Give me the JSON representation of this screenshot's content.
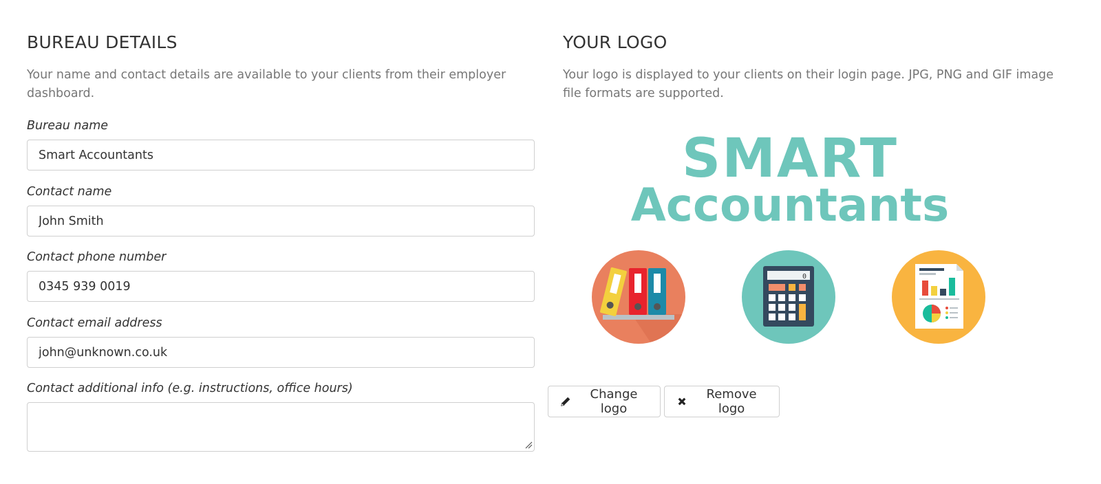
{
  "bureau": {
    "title": "BUREAU DETAILS",
    "description": "Your name and contact details are available to your clients from their employer dashboard.",
    "fields": {
      "bureau_name": {
        "label": "Bureau name",
        "value": "Smart Accountants"
      },
      "contact_name": {
        "label": "Contact name",
        "value": "John Smith"
      },
      "contact_phone": {
        "label": "Contact phone number",
        "value": "0345 939 0019"
      },
      "contact_email": {
        "label": "Contact email address",
        "value": "john@unknown.co.uk"
      },
      "contact_info": {
        "label": "Contact additional info (e.g. instructions, office hours)",
        "value": ""
      }
    }
  },
  "logo": {
    "title": "YOUR LOGO",
    "description": "Your logo is displayed to your clients on their login page. JPG, PNG and GIF image file formats are supported.",
    "image_text_line1": "SMART",
    "image_text_line2": "Accountants",
    "icons": [
      "binders-icon",
      "calculator-icon",
      "report-icon"
    ],
    "change_label": "Change logo",
    "remove_label": "Remove logo"
  },
  "colors": {
    "brand_teal": "#6ec6bb",
    "orange_circle": "#e9805e",
    "yellow_circle": "#f9b440",
    "border": "#cfcfcf"
  }
}
